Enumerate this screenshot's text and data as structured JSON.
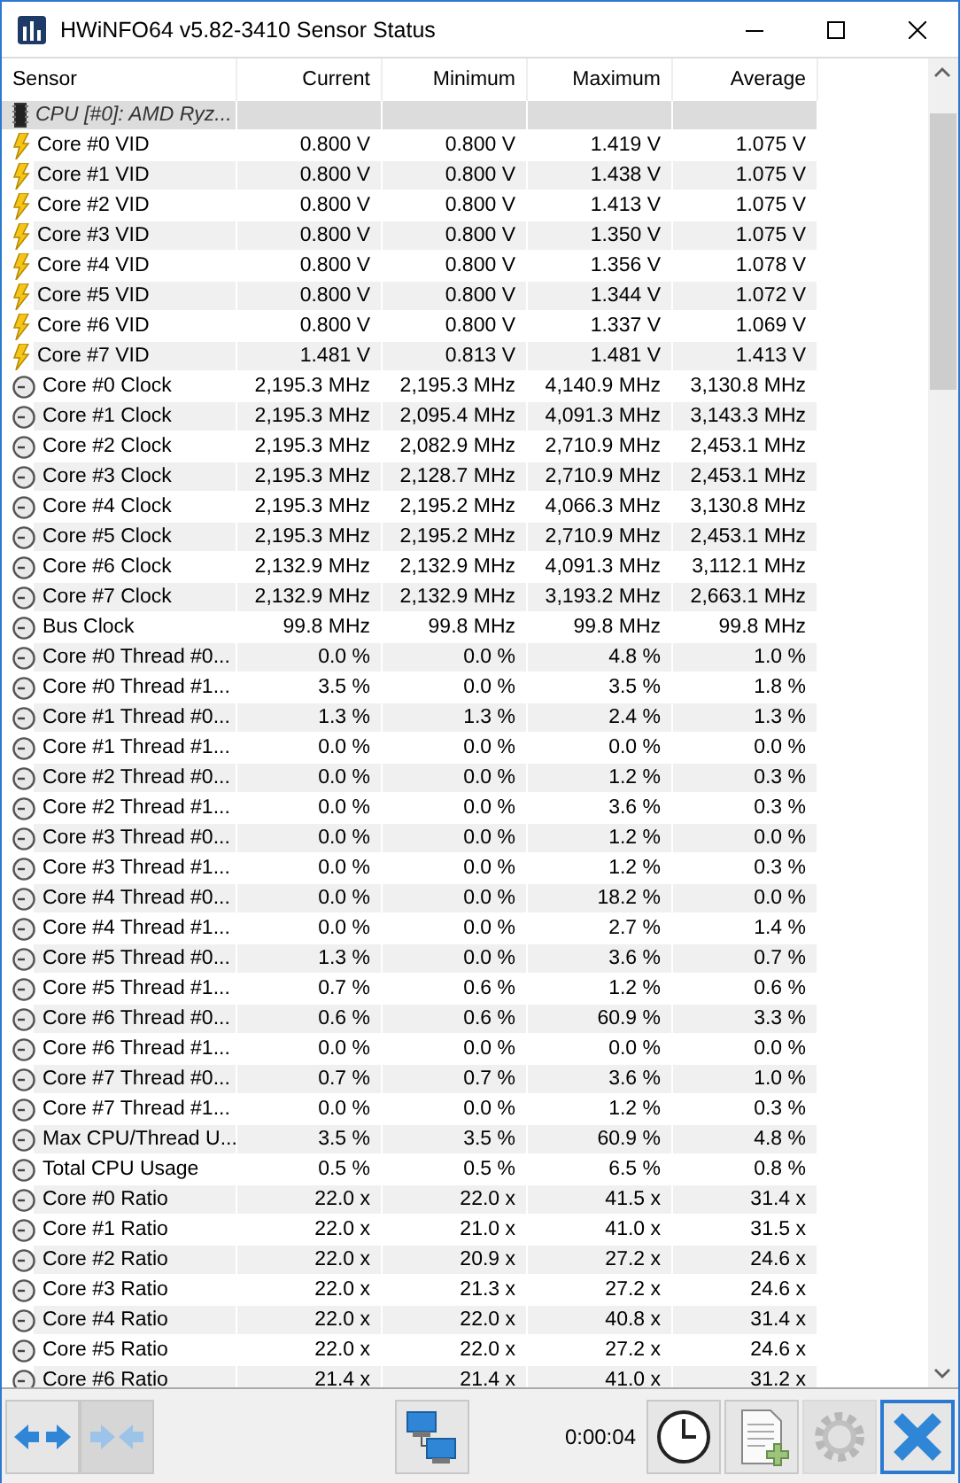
{
  "window": {
    "title": "HWiNFO64 v5.82-3410 Sensor Status"
  },
  "table": {
    "columns": [
      "Sensor",
      "Current",
      "Minimum",
      "Maximum",
      "Average"
    ],
    "rows": [
      {
        "kind": "group",
        "sensor": "CPU [#0]: AMD Ryz...",
        "values": []
      },
      {
        "kind": "voltage",
        "sensor": "Core #0 VID",
        "values": [
          "0.800 V",
          "0.800 V",
          "1.419 V",
          "1.075 V"
        ]
      },
      {
        "kind": "voltage",
        "sensor": "Core #1 VID",
        "values": [
          "0.800 V",
          "0.800 V",
          "1.438 V",
          "1.075 V"
        ]
      },
      {
        "kind": "voltage",
        "sensor": "Core #2 VID",
        "values": [
          "0.800 V",
          "0.800 V",
          "1.413 V",
          "1.075 V"
        ]
      },
      {
        "kind": "voltage",
        "sensor": "Core #3 VID",
        "values": [
          "0.800 V",
          "0.800 V",
          "1.350 V",
          "1.075 V"
        ]
      },
      {
        "kind": "voltage",
        "sensor": "Core #4 VID",
        "values": [
          "0.800 V",
          "0.800 V",
          "1.356 V",
          "1.078 V"
        ]
      },
      {
        "kind": "voltage",
        "sensor": "Core #5 VID",
        "values": [
          "0.800 V",
          "0.800 V",
          "1.344 V",
          "1.072 V"
        ]
      },
      {
        "kind": "voltage",
        "sensor": "Core #6 VID",
        "values": [
          "0.800 V",
          "0.800 V",
          "1.337 V",
          "1.069 V"
        ]
      },
      {
        "kind": "voltage",
        "sensor": "Core #7 VID",
        "values": [
          "1.481 V",
          "0.813 V",
          "1.481 V",
          "1.413 V"
        ]
      },
      {
        "kind": "gauge",
        "sensor": "Core #0 Clock",
        "values": [
          "2,195.3 MHz",
          "2,195.3 MHz",
          "4,140.9 MHz",
          "3,130.8 MHz"
        ]
      },
      {
        "kind": "gauge",
        "sensor": "Core #1 Clock",
        "values": [
          "2,195.3 MHz",
          "2,095.4 MHz",
          "4,091.3 MHz",
          "3,143.3 MHz"
        ]
      },
      {
        "kind": "gauge",
        "sensor": "Core #2 Clock",
        "values": [
          "2,195.3 MHz",
          "2,082.9 MHz",
          "2,710.9 MHz",
          "2,453.1 MHz"
        ]
      },
      {
        "kind": "gauge",
        "sensor": "Core #3 Clock",
        "values": [
          "2,195.3 MHz",
          "2,128.7 MHz",
          "2,710.9 MHz",
          "2,453.1 MHz"
        ]
      },
      {
        "kind": "gauge",
        "sensor": "Core #4 Clock",
        "values": [
          "2,195.3 MHz",
          "2,195.2 MHz",
          "4,066.3 MHz",
          "3,130.8 MHz"
        ]
      },
      {
        "kind": "gauge",
        "sensor": "Core #5 Clock",
        "values": [
          "2,195.3 MHz",
          "2,195.2 MHz",
          "2,710.9 MHz",
          "2,453.1 MHz"
        ]
      },
      {
        "kind": "gauge",
        "sensor": "Core #6 Clock",
        "values": [
          "2,132.9 MHz",
          "2,132.9 MHz",
          "4,091.3 MHz",
          "3,112.1 MHz"
        ]
      },
      {
        "kind": "gauge",
        "sensor": "Core #7 Clock",
        "values": [
          "2,132.9 MHz",
          "2,132.9 MHz",
          "3,193.2 MHz",
          "2,663.1 MHz"
        ]
      },
      {
        "kind": "gauge",
        "sensor": "Bus Clock",
        "values": [
          "99.8 MHz",
          "99.8 MHz",
          "99.8 MHz",
          "99.8 MHz"
        ]
      },
      {
        "kind": "gauge",
        "sensor": "Core #0 Thread #0...",
        "values": [
          "0.0 %",
          "0.0 %",
          "4.8 %",
          "1.0 %"
        ]
      },
      {
        "kind": "gauge",
        "sensor": "Core #0 Thread #1...",
        "values": [
          "3.5 %",
          "0.0 %",
          "3.5 %",
          "1.8 %"
        ]
      },
      {
        "kind": "gauge",
        "sensor": "Core #1 Thread #0...",
        "values": [
          "1.3 %",
          "1.3 %",
          "2.4 %",
          "1.3 %"
        ]
      },
      {
        "kind": "gauge",
        "sensor": "Core #1 Thread #1...",
        "values": [
          "0.0 %",
          "0.0 %",
          "0.0 %",
          "0.0 %"
        ]
      },
      {
        "kind": "gauge",
        "sensor": "Core #2 Thread #0...",
        "values": [
          "0.0 %",
          "0.0 %",
          "1.2 %",
          "0.3 %"
        ]
      },
      {
        "kind": "gauge",
        "sensor": "Core #2 Thread #1...",
        "values": [
          "0.0 %",
          "0.0 %",
          "3.6 %",
          "0.3 %"
        ]
      },
      {
        "kind": "gauge",
        "sensor": "Core #3 Thread #0...",
        "values": [
          "0.0 %",
          "0.0 %",
          "1.2 %",
          "0.0 %"
        ]
      },
      {
        "kind": "gauge",
        "sensor": "Core #3 Thread #1...",
        "values": [
          "0.0 %",
          "0.0 %",
          "1.2 %",
          "0.3 %"
        ]
      },
      {
        "kind": "gauge",
        "sensor": "Core #4 Thread #0...",
        "values": [
          "0.0 %",
          "0.0 %",
          "18.2 %",
          "0.0 %"
        ]
      },
      {
        "kind": "gauge",
        "sensor": "Core #4 Thread #1...",
        "values": [
          "0.0 %",
          "0.0 %",
          "2.7 %",
          "1.4 %"
        ]
      },
      {
        "kind": "gauge",
        "sensor": "Core #5 Thread #0...",
        "values": [
          "1.3 %",
          "0.0 %",
          "3.6 %",
          "0.7 %"
        ]
      },
      {
        "kind": "gauge",
        "sensor": "Core #5 Thread #1...",
        "values": [
          "0.7 %",
          "0.6 %",
          "1.2 %",
          "0.6 %"
        ]
      },
      {
        "kind": "gauge",
        "sensor": "Core #6 Thread #0...",
        "values": [
          "0.6 %",
          "0.6 %",
          "60.9 %",
          "3.3 %"
        ]
      },
      {
        "kind": "gauge",
        "sensor": "Core #6 Thread #1...",
        "values": [
          "0.0 %",
          "0.0 %",
          "0.0 %",
          "0.0 %"
        ]
      },
      {
        "kind": "gauge",
        "sensor": "Core #7 Thread #0...",
        "values": [
          "0.7 %",
          "0.7 %",
          "3.6 %",
          "1.0 %"
        ]
      },
      {
        "kind": "gauge",
        "sensor": "Core #7 Thread #1...",
        "values": [
          "0.0 %",
          "0.0 %",
          "1.2 %",
          "0.3 %"
        ]
      },
      {
        "kind": "gauge",
        "sensor": "Max CPU/Thread U...",
        "values": [
          "3.5 %",
          "3.5 %",
          "60.9 %",
          "4.8 %"
        ]
      },
      {
        "kind": "gauge",
        "sensor": "Total CPU Usage",
        "values": [
          "0.5 %",
          "0.5 %",
          "6.5 %",
          "0.8 %"
        ]
      },
      {
        "kind": "gauge",
        "sensor": "Core #0 Ratio",
        "values": [
          "22.0 x",
          "22.0 x",
          "41.5 x",
          "31.4 x"
        ]
      },
      {
        "kind": "gauge",
        "sensor": "Core #1 Ratio",
        "values": [
          "22.0 x",
          "21.0 x",
          "41.0 x",
          "31.5 x"
        ]
      },
      {
        "kind": "gauge",
        "sensor": "Core #2 Ratio",
        "values": [
          "22.0 x",
          "20.9 x",
          "27.2 x",
          "24.6 x"
        ]
      },
      {
        "kind": "gauge",
        "sensor": "Core #3 Ratio",
        "values": [
          "22.0 x",
          "21.3 x",
          "27.2 x",
          "24.6 x"
        ]
      },
      {
        "kind": "gauge",
        "sensor": "Core #4 Ratio",
        "values": [
          "22.0 x",
          "22.0 x",
          "40.8 x",
          "31.4 x"
        ]
      },
      {
        "kind": "gauge",
        "sensor": "Core #5 Ratio",
        "values": [
          "22.0 x",
          "22.0 x",
          "27.2 x",
          "24.6 x"
        ]
      },
      {
        "kind": "gauge",
        "sensor": "Core #6 Ratio",
        "values": [
          "21.4 x",
          "21.4 x",
          "41.0 x",
          "31.2 x"
        ]
      }
    ]
  },
  "toolbar": {
    "left": [
      {
        "kind": "expand",
        "disabled": false
      },
      {
        "kind": "collapse",
        "disabled": true
      }
    ],
    "right": [
      {
        "kind": "network",
        "disabled": false
      },
      {
        "kind": "timer",
        "label": "0:00:04"
      },
      {
        "kind": "clock",
        "disabled": false
      },
      {
        "kind": "report",
        "disabled": false
      },
      {
        "kind": "settings",
        "disabled": true
      },
      {
        "kind": "close",
        "disabled": false
      }
    ]
  }
}
